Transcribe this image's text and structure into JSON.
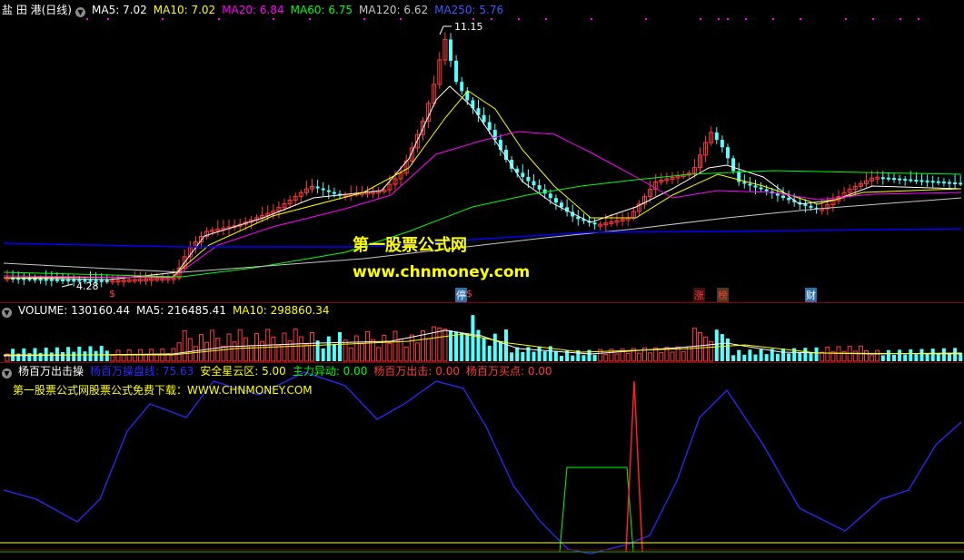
{
  "colors": {
    "rise": "#ff3b3b",
    "fall": "#54ffff",
    "ma5": "#ffffff",
    "ma10": "#ffff00",
    "ma20": "#ff00ff",
    "ma60": "#00ff00",
    "ma120": "#c8c8c8",
    "ma250": "#0000ff",
    "ygreen": "#00ff00",
    "yellowText": "#ffff00"
  },
  "main": {
    "toggle_icon": "chevron-down-icon",
    "stock_name": "盐 田 港(日线)",
    "ma5": "MA5: 7.02",
    "ma10": "MA10: 7.02",
    "ma20": "MA20: 6.84",
    "ma60": "MA60: 6.75",
    "ma120": "MA120: 6.62",
    "ma250": "MA250: 5.76",
    "high_label": "11.15",
    "low_label": "4.28",
    "watermark_cn": "第一股票公式网",
    "watermark_url": "www.chnmoney.com",
    "markers": [
      {
        "text": "$",
        "color": "#ff3b3b",
        "bg": "none"
      },
      {
        "text": "停",
        "color": "#ffffff",
        "bg": "#2f6fa8"
      },
      {
        "text": "$",
        "color": "#ff3b3b",
        "bg": "none"
      },
      {
        "text": "涨",
        "color": "#ff3b3b",
        "bg": "#4a1a1a"
      },
      {
        "text": "榜",
        "color": "#ff3b3b",
        "bg": "#4a3a1a"
      },
      {
        "text": "财",
        "color": "#ffffff",
        "bg": "#2f6fa8"
      }
    ]
  },
  "volume": {
    "label": "VOLUME: 130160.44",
    "ma5": "MA5: 216485.41",
    "ma10": "MA10: 298860.34"
  },
  "indicator": {
    "name": "杨百万出击操",
    "line": "杨百万操盘线: 75.63",
    "safe": "安全星云区: 5.00",
    "anomaly": "主力异动: 0.00",
    "strike": "杨百万出击: 0.00",
    "buy": "杨百万买点: 0.00",
    "promo": "第一股票公式网股票公式免费下载：WWW.CHNMONEY.COM"
  }
}
